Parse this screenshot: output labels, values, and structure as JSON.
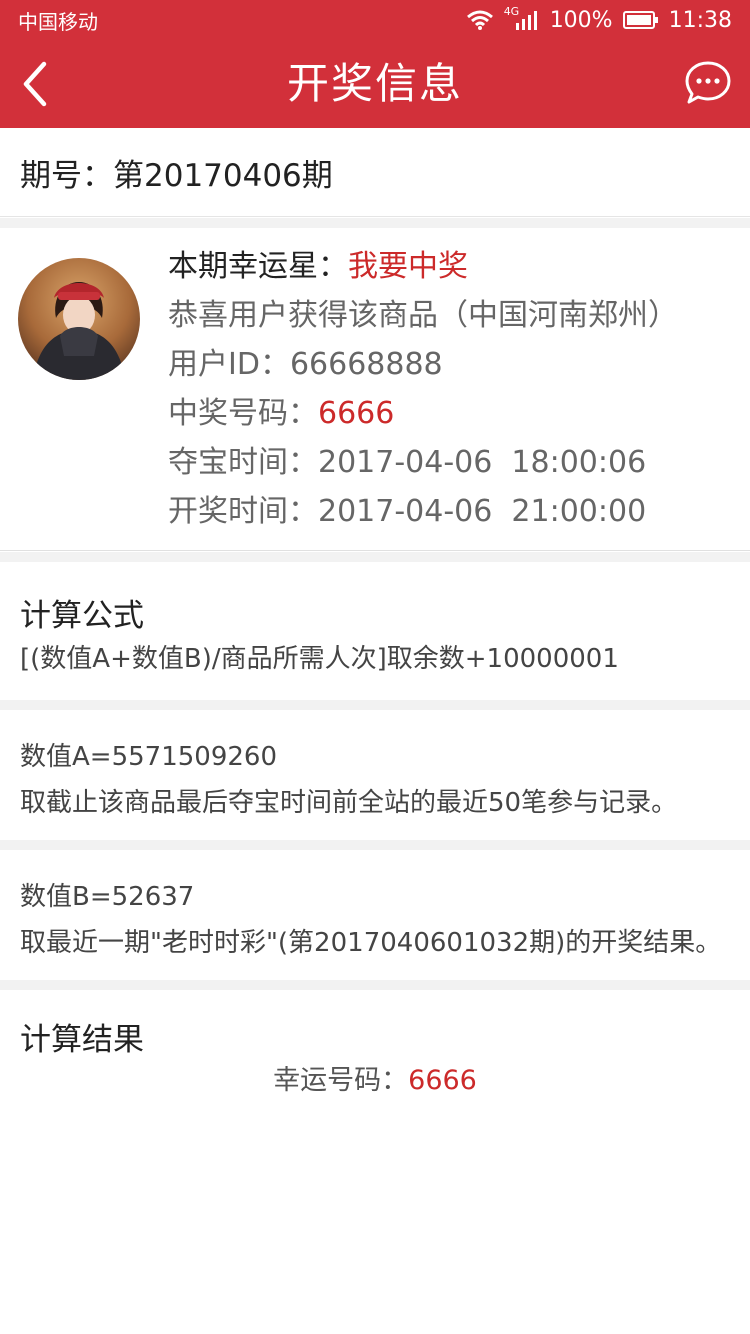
{
  "status_bar": {
    "carrier": "中国移动",
    "network": "4G",
    "battery": "100%",
    "time": "11:38"
  },
  "nav": {
    "title": "开奖信息"
  },
  "period": {
    "label": "期号：",
    "value": "第20170406期"
  },
  "winner": {
    "lucky_star_label": "本期幸运星：",
    "lucky_star_name": "我要中奖",
    "congrats": "恭喜用户获得该商品（中国河南郑州）",
    "user_id_label": "用户ID：",
    "user_id": "66668888",
    "winning_number_label": "中奖号码：",
    "winning_number": "6666",
    "bid_time_label": "夺宝时间：",
    "bid_time": "2017-04-06  18:00:06",
    "draw_time_label": "开奖时间：",
    "draw_time": "2017-04-06  21:00:00"
  },
  "formula": {
    "title": "计算公式",
    "text": "[(数值A+数值B)/商品所需人次]取余数+10000001"
  },
  "value_a": {
    "title": "数值A=5571509260",
    "desc": "取截止该商品最后夺宝时间前全站的最近50笔参与记录。"
  },
  "value_b": {
    "title": "数值B=52637",
    "desc": "取最近一期\"老时时彩\"(第2017040601032期)的开奖结果。"
  },
  "result": {
    "title": "计算结果",
    "lucky_label": "幸运号码：",
    "lucky_number": "6666"
  },
  "colors": {
    "brand_red": "#d2303a",
    "highlight_red": "#cc2a2a"
  },
  "icons": [
    "back-arrow-icon",
    "chat-bubble-icon",
    "wifi-icon",
    "signal-icon",
    "battery-icon"
  ]
}
